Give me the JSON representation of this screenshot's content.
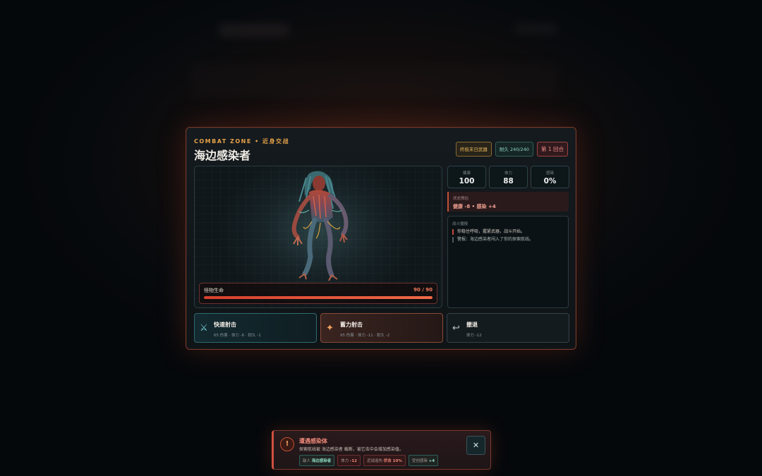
{
  "panel": {
    "zone": "COMBAT ZONE • 近身交战",
    "title": "海边感染者",
    "badges": {
      "weapon": "终极末日武器",
      "durability": "耐久 240/240",
      "round": "第 1 回合"
    }
  },
  "monster": {
    "hp_label": "怪物生命",
    "hp_text": "90 / 90",
    "hp_current": 90,
    "hp_max": 90
  },
  "stats": [
    {
      "label": "健康",
      "value": "100"
    },
    {
      "label": "体力",
      "value": "88"
    },
    {
      "label": "感染",
      "value": "0%"
    }
  ],
  "status": {
    "label": "状态预估",
    "value": "健康 -8 • 感染 +4"
  },
  "log": {
    "label": "战斗播报",
    "lines": [
      "你稳住呼吸，握紧武器，战斗开始。",
      "警报：海边感染者闯入了你的探索航线。"
    ]
  },
  "actions": [
    {
      "icon": "⚔",
      "name": "快速射击",
      "desc": "65 伤害 · 体力 -6 · 耐久 -1"
    },
    {
      "icon": "✦",
      "name": "蓄力射击",
      "desc": "95 伤害 · 体力 -11 · 耐久 -2"
    },
    {
      "icon": "↩",
      "name": "撤退",
      "desc": "体力 -12"
    }
  ],
  "toast": {
    "icon": "!",
    "title": "遭遇感染体",
    "body": "探索航线被 海边感染者 截断。被它击中会增加感染值。",
    "chips": [
      {
        "label": "敌人",
        "value": "海边感染者"
      },
      {
        "label": "体力",
        "value": "-12"
      },
      {
        "label": "近战追伤",
        "value": "伏击 10%"
      },
      {
        "label": "受创感染",
        "value": "+4"
      }
    ],
    "close": "✕"
  },
  "colors": {
    "accent": "#e6a24a",
    "danger": "#d8402e",
    "teal": "#2f6a72"
  }
}
